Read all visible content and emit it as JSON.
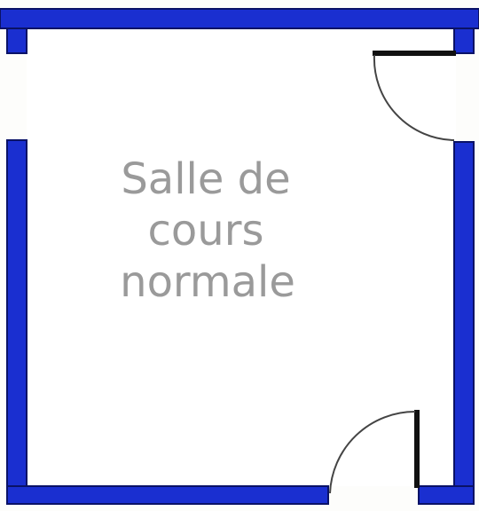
{
  "room": {
    "label_lines": [
      "Salle de",
      "cours",
      "normale"
    ]
  },
  "colors": {
    "wall": "#1a2fd0",
    "wall_outline": "#0a1266",
    "door": "#111111",
    "label": "#9a9a9a",
    "background": "#fdfdfb"
  }
}
